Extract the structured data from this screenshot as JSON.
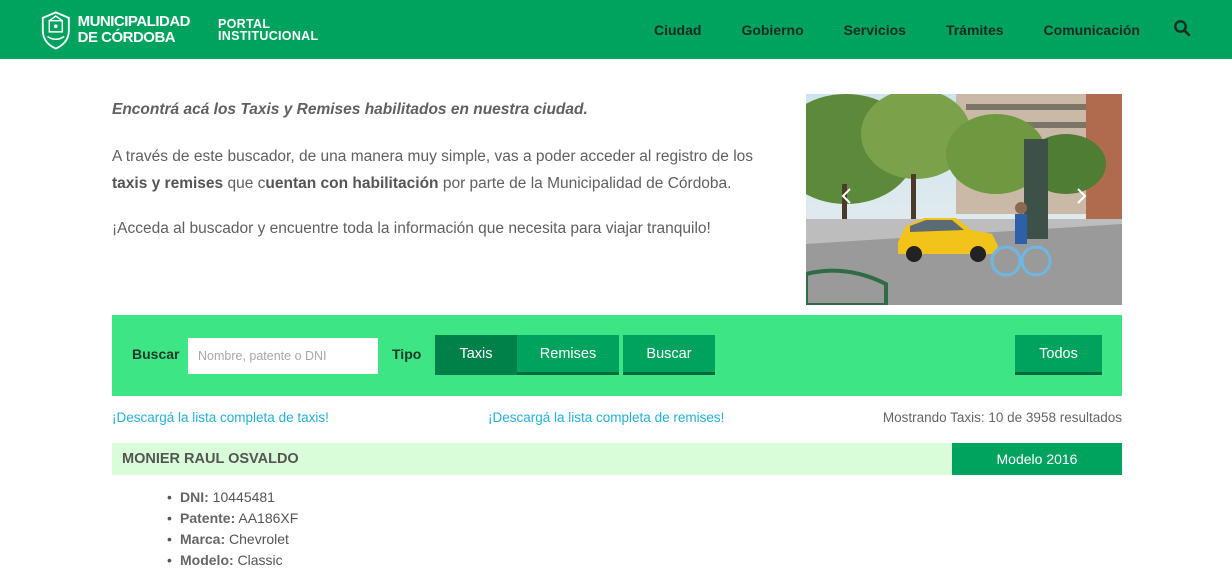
{
  "header": {
    "logo_line1": "MUNICIPALIDAD",
    "logo_line2": "DE CÓRDOBA",
    "portal_line1": "PORTAL",
    "portal_line2": "INSTITUCIONAL",
    "nav": [
      {
        "label": "Ciudad"
      },
      {
        "label": "Gobierno"
      },
      {
        "label": "Servicios"
      },
      {
        "label": "Trámites"
      },
      {
        "label": "Comunicación"
      }
    ],
    "brand_color": "#00a35e"
  },
  "intro": {
    "lead": "Encontrá acá los Taxis y Remises habilitados en nuestra ciudad.",
    "p1_a": "A través de este buscador, de una manera muy simple, vas a poder acceder al registro de los ",
    "p1_b": "taxis y remises",
    "p1_c": " que c",
    "p1_d": "uentan con habilitación",
    "p1_e": " por parte de la Municipalidad de Córdoba.",
    "p2": "¡Acceda al buscador y encuentre toda la información que necesita para viajar tranquilo!"
  },
  "search": {
    "label": "Buscar",
    "placeholder": "Nombre, patente o DNI",
    "value": "",
    "tipo_label": "Tipo",
    "type_options": [
      {
        "label": "Taxis",
        "active": true
      },
      {
        "label": "Remises",
        "active": false
      }
    ],
    "search_button": "Buscar",
    "all_button": "Todos",
    "bar_color": "#3de584"
  },
  "links": {
    "download_taxis": "¡Descargá la lista completa de taxis!",
    "download_remises": "¡Descargá la lista completa de remises!",
    "results": "Mostrando Taxis: 10 de 3958 resultados"
  },
  "results": [
    {
      "name": "MONIER RAUL OSVALDO",
      "model_badge": "Modelo 2016",
      "fields": [
        {
          "key": "DNI:",
          "value": "10445481"
        },
        {
          "key": "Patente:",
          "value": "AA186XF"
        },
        {
          "key": "Marca:",
          "value": "Chevrolet"
        },
        {
          "key": "Modelo:",
          "value": "Classic"
        }
      ]
    }
  ]
}
